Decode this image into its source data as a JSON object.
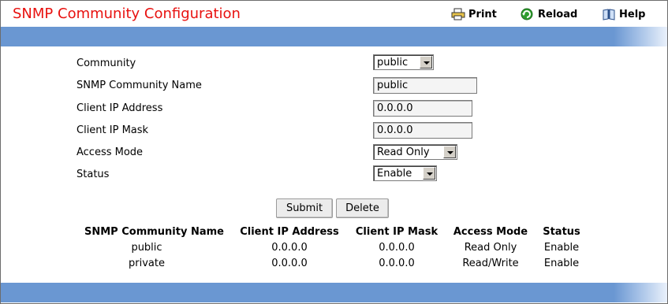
{
  "header": {
    "title": "SNMP Community Configuration",
    "print_label": "Print",
    "reload_label": "Reload",
    "help_label": "Help"
  },
  "form": {
    "community_label": "Community",
    "community_value": "public",
    "name_label": "SNMP Community Name",
    "name_value": "public",
    "ip_label": "Client IP Address",
    "ip_value": "0.0.0.0",
    "mask_label": "Client IP Mask",
    "mask_value": "0.0.0.0",
    "access_label": "Access Mode",
    "access_value": "Read Only",
    "status_label": "Status",
    "status_value": "Enable"
  },
  "actions": {
    "submit_label": "Submit",
    "delete_label": "Delete"
  },
  "table": {
    "headers": [
      "SNMP Community Name",
      "Client IP Address",
      "Client IP Mask",
      "Access Mode",
      "Status"
    ],
    "rows": [
      [
        "public",
        "0.0.0.0",
        "0.0.0.0",
        "Read Only",
        "Enable"
      ],
      [
        "private",
        "0.0.0.0",
        "0.0.0.0",
        "Read/Write",
        "Enable"
      ]
    ]
  },
  "colors": {
    "title": "#e8110f",
    "bar": "#6a97d2"
  },
  "icons": {
    "print": "printer-icon",
    "reload": "reload-icon",
    "help": "help-book-icon"
  }
}
